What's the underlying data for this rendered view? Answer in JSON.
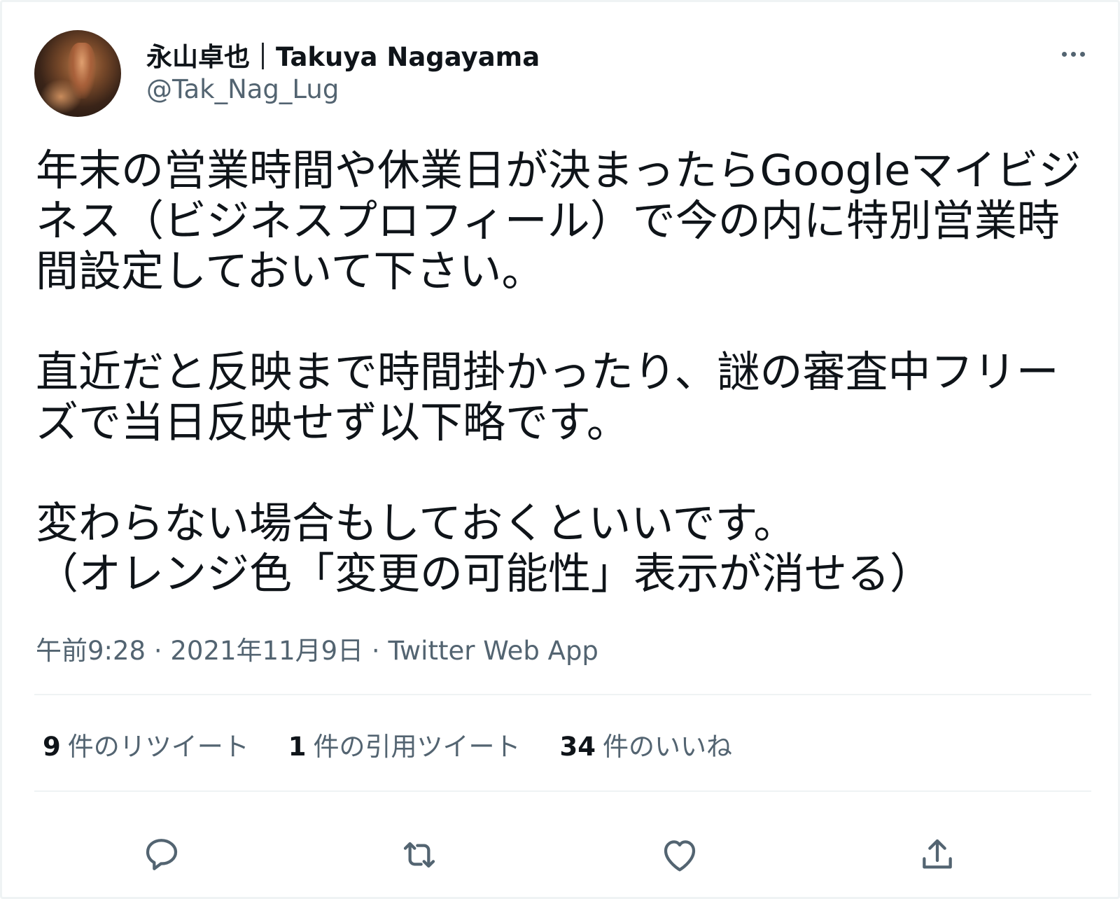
{
  "tweet": {
    "display_name": "永山卓也｜Takuya Nagayama",
    "handle": "@Tak_Nag_Lug",
    "lines": [
      "年末の営業時間や休業日が決まったらGoogleマイビジ",
      "ネス（ビジネスプロフィール）で今の内に特別営業時",
      "間設定しておいて下さい。",
      "",
      "直近だと反映まで時間掛かったり、謎の審査中フリー",
      "ズで当日反映せず以下略です。",
      "",
      "変わらない場合もしておくといいです。",
      "（オレンジ色「変更の可能性」表示が消せる）"
    ],
    "meta": "午前9:28 · 2021年11月9日 · Twitter Web App"
  },
  "stats": {
    "retweets": {
      "count": "9",
      "label": "件のリツイート"
    },
    "quotes": {
      "count": "1",
      "label": "件の引用ツイート"
    },
    "likes": {
      "count": "34",
      "label": "件のいいね"
    }
  },
  "icons": {
    "more": "more-icon",
    "reply": "reply-icon",
    "retweet": "retweet-icon",
    "like": "like-icon",
    "share": "share-icon"
  },
  "colors": {
    "text": "#0f1419",
    "secondary": "#536471",
    "divider": "#eff3f4"
  }
}
